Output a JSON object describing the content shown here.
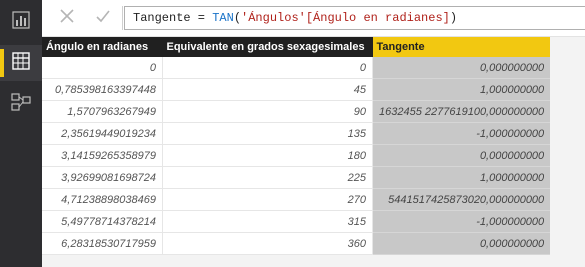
{
  "toolbar": {
    "cancel_icon": "close-icon",
    "commit_icon": "check-icon",
    "formula": {
      "prefix": "Tangente = ",
      "fn": "TAN",
      "open": "(",
      "arg": "'Ángulos'[Ángulo en radianes]",
      "close": ")"
    }
  },
  "sidebar": {
    "items": [
      {
        "name": "report-view",
        "icon": "bar-chart-icon",
        "active": false
      },
      {
        "name": "data-view",
        "icon": "table-grid-icon",
        "active": true
      },
      {
        "name": "relationships-view",
        "icon": "relationships-icon",
        "active": false
      }
    ]
  },
  "table": {
    "headers": [
      "Ángulo en radianes",
      "Equivalente en grados sexagesimales",
      "Tangente"
    ],
    "selected_column": 2,
    "rows": [
      [
        "0",
        "0",
        "0,000000000"
      ],
      [
        "0,785398163397448",
        "45",
        "1,000000000"
      ],
      [
        "1,5707963267949",
        "90",
        "1632455 2277619100,000000000"
      ],
      [
        "2,35619449019234",
        "135",
        "-1,000000000"
      ],
      [
        "3,14159265358979",
        "180",
        "0,000000000"
      ],
      [
        "3,92699081698724",
        "225",
        "1,000000000"
      ],
      [
        "4,71238898038469",
        "270",
        "5441517425873020,000000000"
      ],
      [
        "5,49778714378214",
        "315",
        "-1,000000000"
      ],
      [
        "6,28318530717959",
        "360",
        "0,000000000"
      ]
    ]
  },
  "colors": {
    "rail": "#2d2d30",
    "accent": "#f2c811",
    "header_dark": "#202020",
    "selected_cell": "#c8c8c8"
  }
}
